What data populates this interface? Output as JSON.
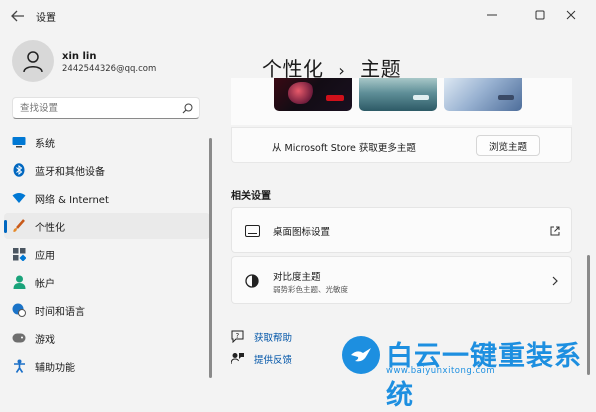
{
  "app": {
    "title": "设置",
    "back_icon": "back-arrow-icon",
    "window_controls": [
      "minimize-icon",
      "maximize-icon",
      "close-icon"
    ]
  },
  "profile": {
    "name": "xin lin",
    "email": "2442544326@qq.com"
  },
  "search": {
    "placeholder": "查找设置",
    "value": ""
  },
  "sidebar": {
    "items": [
      {
        "label": "系统",
        "icon": "monitor-icon",
        "color": "#0078d4",
        "active": false
      },
      {
        "label": "蓝牙和其他设备",
        "icon": "bluetooth-icon",
        "color": "#0067c0",
        "active": false
      },
      {
        "label": "网络 & Internet",
        "icon": "wifi-icon",
        "color": "#0078d4",
        "active": false
      },
      {
        "label": "个性化",
        "icon": "brush-icon",
        "color": "#c85a1a",
        "active": true
      },
      {
        "label": "应用",
        "icon": "apps-icon",
        "color": "#4a5560",
        "active": false
      },
      {
        "label": "帐户",
        "icon": "account-icon",
        "color": "#1aa37a",
        "active": false
      },
      {
        "label": "时间和语言",
        "icon": "globe-clock-icon",
        "color": "#1a73c8",
        "active": false
      },
      {
        "label": "游戏",
        "icon": "gamepad-icon",
        "color": "#6e6e6e",
        "active": false
      },
      {
        "label": "辅助功能",
        "icon": "accessibility-icon",
        "color": "#1a6fc8",
        "active": false
      }
    ]
  },
  "header": {
    "crumb_parent": "个性化",
    "separator": "›",
    "crumb_current": "主题"
  },
  "themes": {
    "thumbnails": [
      {
        "name": "theme-thumb-dark",
        "accent": "#d0101a"
      },
      {
        "name": "theme-thumb-lake",
        "accent": "#5d9aa8"
      },
      {
        "name": "theme-thumb-bloom",
        "accent": "#3a4a66"
      }
    ],
    "store_text": "从 Microsoft Store 获取更多主题",
    "browse_button": "浏览主题"
  },
  "related": {
    "heading": "相关设置",
    "cards": [
      {
        "title": "桌面图标设置",
        "subtitle": "",
        "icon": "desktop-icon",
        "action_icon": "open-external-icon"
      },
      {
        "title": "对比度主题",
        "subtitle": "弱势彩色主题、光敏度",
        "icon": "contrast-icon",
        "action_icon": "chevron-right-icon"
      }
    ]
  },
  "help_links": [
    {
      "label": "获取帮助",
      "icon": "help-chat-icon"
    },
    {
      "label": "提供反馈",
      "icon": "feedback-icon"
    }
  ],
  "watermark": {
    "title": "白云一键重装系统",
    "url": "www.baiyunxitong.com",
    "logo": "bird-logo-icon"
  },
  "colors": {
    "accent": "#0067c0",
    "link": "#0055a8",
    "watermark": "#1d8fe0"
  }
}
